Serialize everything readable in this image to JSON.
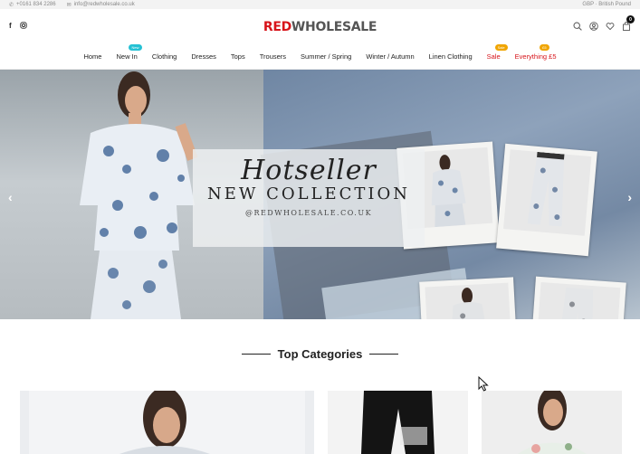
{
  "topbar": {
    "phone": "+0161 834 2286",
    "email": "info@redwholesale.co.uk",
    "currency": "GBP · British Pound"
  },
  "header": {
    "logo_part1": "RED",
    "logo_part2": "WHOLESALE",
    "cart_count": "0"
  },
  "nav": {
    "items": [
      {
        "label": "Home"
      },
      {
        "label": "New In",
        "badge": "New"
      },
      {
        "label": "Clothing"
      },
      {
        "label": "Dresses"
      },
      {
        "label": "Tops"
      },
      {
        "label": "Trousers"
      },
      {
        "label": "Summer / Spring"
      },
      {
        "label": "Winter / Autumn"
      },
      {
        "label": "Linen Clothing"
      },
      {
        "label": "Sale",
        "badge": "Sale"
      },
      {
        "label": "Everything £5",
        "badge": "£5"
      }
    ]
  },
  "hero": {
    "script_title": "Hotseller",
    "title": "NEW COLLECTION",
    "url": "@REDWHOLESALE.CO.UK",
    "prev": "‹",
    "next": "›"
  },
  "section": {
    "title": "Top Categories"
  },
  "colors": {
    "brand_red": "#d7141a",
    "badge_new": "#25c1d4",
    "badge_sale": "#f0a500"
  }
}
